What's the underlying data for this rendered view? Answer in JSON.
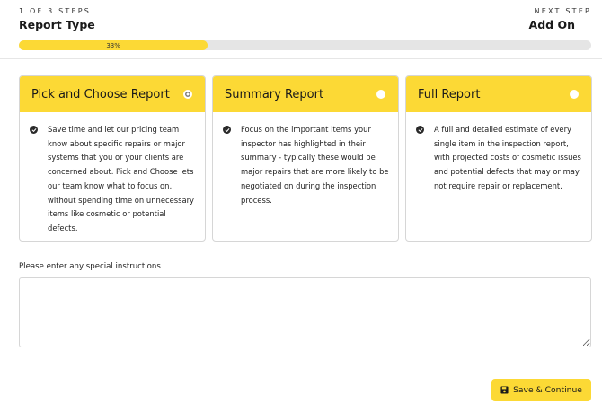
{
  "progress": {
    "step_left": "1 OF 3 STEPS",
    "step_right": "NEXT STEP",
    "title_left": "Report Type",
    "title_right": "Add On",
    "percent_label": "33%",
    "percent": 33
  },
  "cards": [
    {
      "title": "Pick and Choose Report",
      "selected": true,
      "text": "Save time and let our pricing team know about specific repairs or major systems that you or your clients are concerned about. Pick and Choose lets our team know what to focus on, without spending time on unnecessary items like cosmetic or potential defects."
    },
    {
      "title": "Summary Report",
      "selected": false,
      "text": "Focus on the important items your inspector has highlighted in their summary - typically these would be major repairs that are more likely to be negotiated on during the inspection process."
    },
    {
      "title": "Full Report",
      "selected": false,
      "text": "A full and detailed estimate of every single item in the inspection report, with projected costs of cosmetic issues and potential defects that may or may not require repair or replacement."
    }
  ],
  "instructions": {
    "label": "Please enter any special instructions",
    "value": ""
  },
  "save_button": {
    "label": "Save & Continue",
    "icon": "floppy-disk-icon"
  },
  "colors": {
    "accent": "#fcd935",
    "track": "#e5e5e5"
  }
}
